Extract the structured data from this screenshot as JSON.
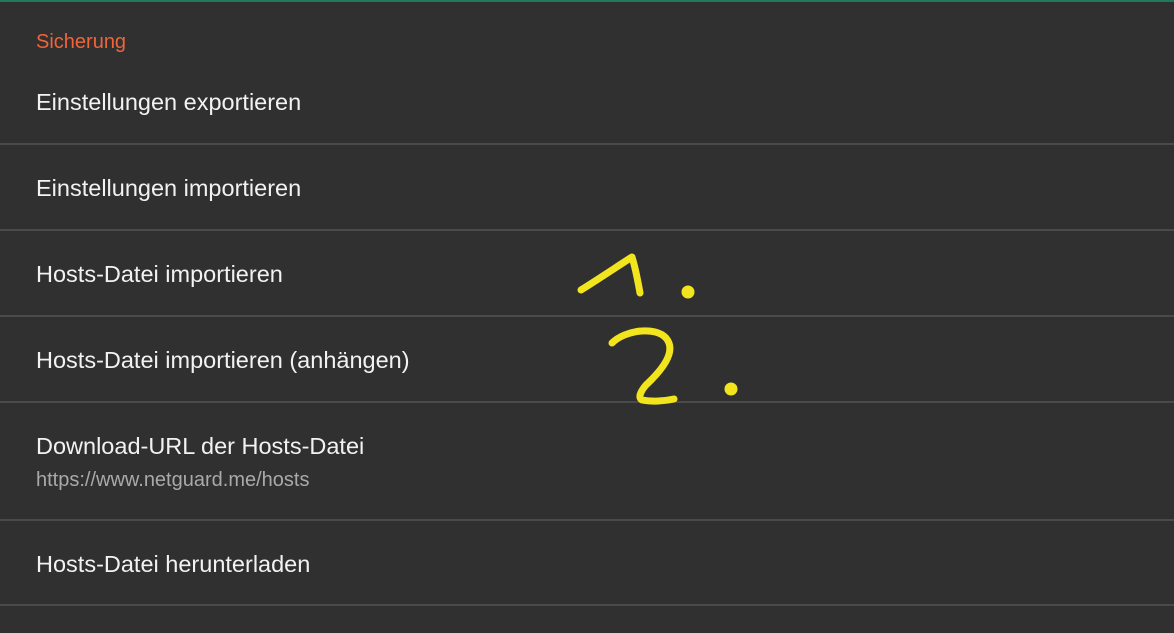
{
  "section": {
    "header": "Sicherung"
  },
  "items": [
    {
      "title": "Einstellungen exportieren"
    },
    {
      "title": "Einstellungen importieren"
    },
    {
      "title": "Hosts-Datei importieren"
    },
    {
      "title": "Hosts-Datei importieren (anhängen)"
    },
    {
      "title": "Download-URL der Hosts-Datei",
      "summary": "https://www.netguard.me/hosts"
    },
    {
      "title": "Hosts-Datei herunterladen"
    }
  ],
  "annotations": {
    "color": "#f2e51e",
    "marks": [
      "1.",
      "2."
    ]
  },
  "colors": {
    "background": "#303030",
    "section_header": "#f0643a",
    "accent_bar": "#1e7a5c",
    "divider": "#4a4a4a"
  }
}
